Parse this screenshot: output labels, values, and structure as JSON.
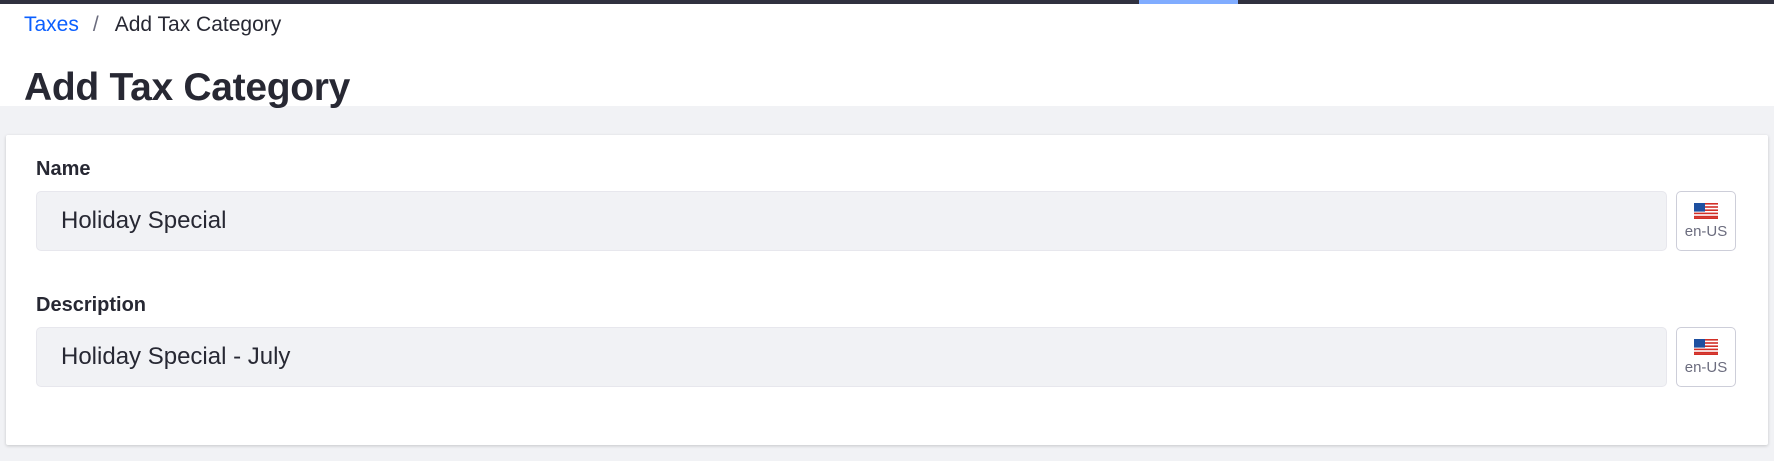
{
  "breadcrumb": {
    "parent": "Taxes",
    "separator": "/",
    "current": "Add Tax Category"
  },
  "page": {
    "title": "Add Tax Category"
  },
  "form": {
    "name": {
      "label": "Name",
      "value": "Holiday Special",
      "locale": "en-US",
      "locale_icon": "flag-us-icon"
    },
    "description": {
      "label": "Description",
      "value": "Holiday Special - July",
      "locale": "en-US",
      "locale_icon": "flag-us-icon"
    }
  },
  "colors": {
    "link": "#0b5fff",
    "topbar": "#30313f",
    "progress": "#80acff",
    "input_bg": "#f1f2f5"
  }
}
